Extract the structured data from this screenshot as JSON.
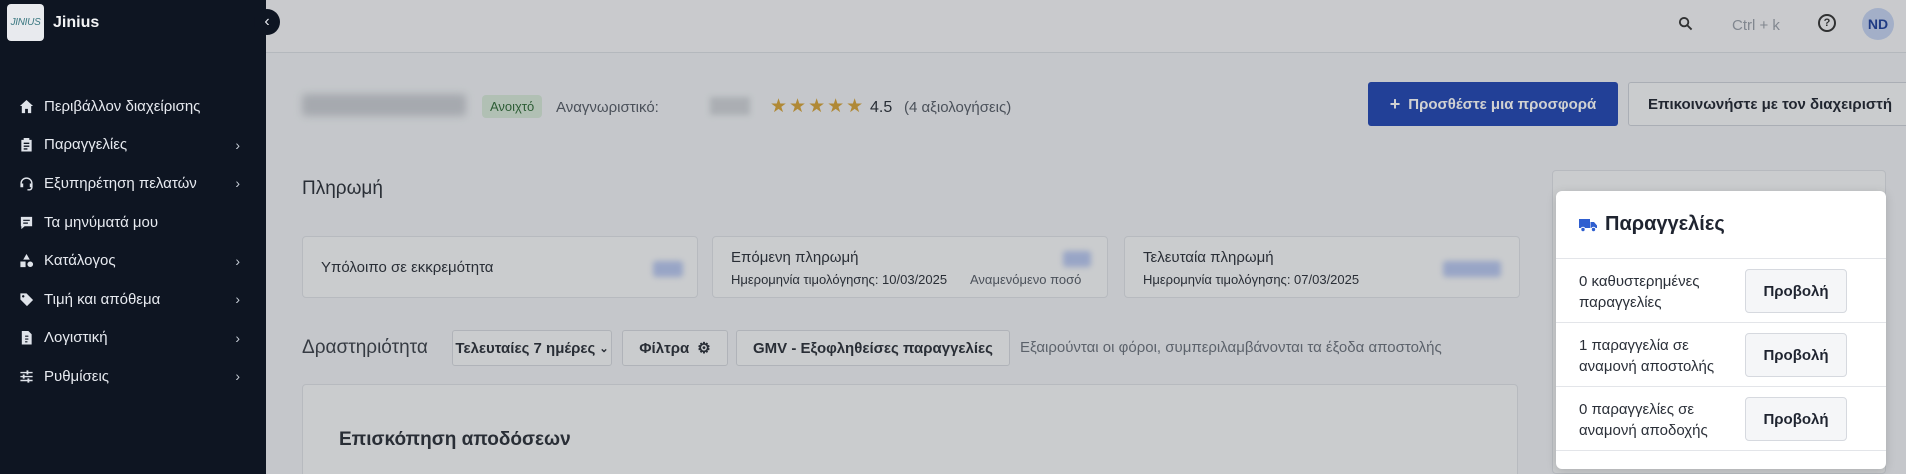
{
  "app": {
    "name": "Jinius",
    "logo_text": "JINIUS"
  },
  "sidebar": {
    "items": [
      {
        "label": "Περιβάλλον διαχείρισης",
        "icon": "home-icon",
        "chevron": false
      },
      {
        "label": "Παραγγελίες",
        "icon": "clipboard-icon",
        "chevron": true
      },
      {
        "label": "Εξυπηρέτηση πελατών",
        "icon": "headset-icon",
        "chevron": true
      },
      {
        "label": "Τα μηνύματά μου",
        "icon": "message-icon",
        "chevron": false
      },
      {
        "label": "Κατάλογος",
        "icon": "shapes-icon",
        "chevron": true
      },
      {
        "label": "Τιμή και απόθεμα",
        "icon": "tag-icon",
        "chevron": true
      },
      {
        "label": "Λογιστική",
        "icon": "invoice-icon",
        "chevron": true
      },
      {
        "label": "Ρυθμίσεις",
        "icon": "sliders-icon",
        "chevron": true
      }
    ]
  },
  "topbar": {
    "search_placeholder": "Ctrl + k",
    "avatar_initials": "ND"
  },
  "shop": {
    "status": "Ανοιχτό",
    "id_label": "Αναγνωριστικό:",
    "stars": "★★★★★",
    "rating": "4.5",
    "reviews": "(4 αξιολογήσεις)",
    "add_offer": "Προσθέστε μια προσφορά",
    "contact_manager": "Επικοινωνήστε με τον διαχειριστή"
  },
  "payment": {
    "title": "Πληρωμή",
    "cards": [
      {
        "title": "Υπόλοιπο σε εκκρεμότητα",
        "sub": "",
        "sub_right": ""
      },
      {
        "title": "Επόμενη πληρωμή",
        "sub": "Ημερομηνία τιμολόγησης: 10/03/2025",
        "sub_right": "Αναμενόμενο ποσό"
      },
      {
        "title": "Τελευταία πληρωμή",
        "sub": "Ημερομηνία τιμολόγησης: 07/03/2025",
        "sub_right": ""
      }
    ]
  },
  "activity": {
    "title": "Δραστηριότητα",
    "period": "Τελευταίες 7 ημέρες",
    "filters": "Φίλτρα",
    "metric": "GMV - Εξοφληθείσες παραγγελίες",
    "note": "Εξαιρούνται οι φόροι, συμπεριλαμβάνονται τα έξοδα αποστολής"
  },
  "performance": {
    "title": "Επισκόπηση αποδόσεων"
  },
  "orders_panel": {
    "title": "Παραγγελίες",
    "rows": [
      {
        "text": "0 καθυστερημένες παραγγελίες",
        "button": "Προβολή"
      },
      {
        "text": "1 παραγγελία σε αναμονή αποστολής",
        "button": "Προβολή"
      },
      {
        "text": "0 παραγγελίες σε αναμονή αποδοχής",
        "button": "Προβολή"
      }
    ]
  },
  "colors": {
    "sidebar_bg": "#0e1522",
    "primary": "#2046b4",
    "star": "#d7a338",
    "truck": "#2f5fd0"
  }
}
